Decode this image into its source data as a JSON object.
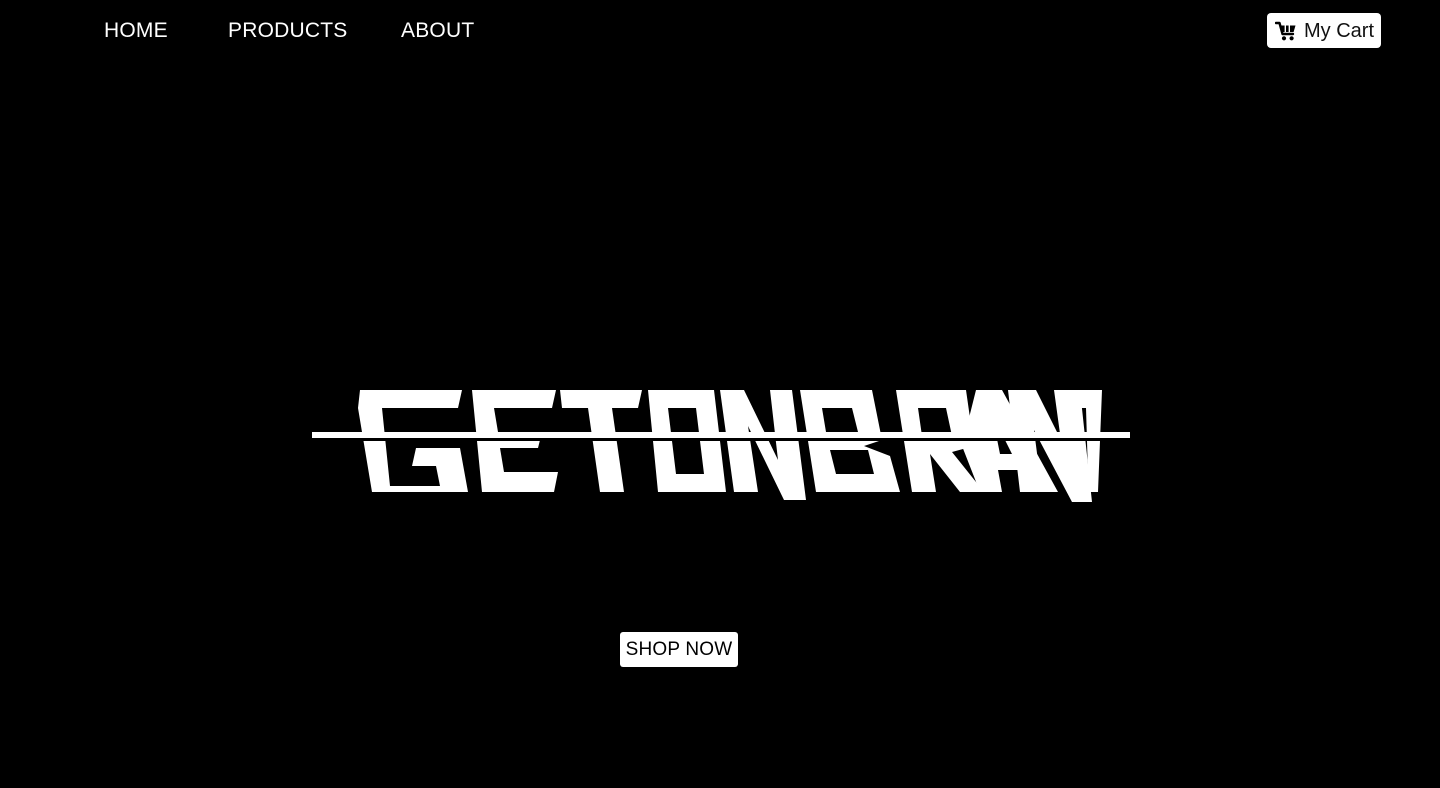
{
  "nav": {
    "links": [
      {
        "label": "HOME"
      },
      {
        "label": "PRODUCTS"
      },
      {
        "label": "ABOUT"
      }
    ],
    "cart": {
      "label": "My Cart",
      "icon": "cart-icon"
    }
  },
  "hero": {
    "logo_text": "GETONBRAND",
    "cta_label": "SHOP NOW"
  },
  "colors": {
    "background": "#000000",
    "foreground": "#ffffff",
    "button_bg": "#ffffff",
    "button_text": "#000000"
  }
}
